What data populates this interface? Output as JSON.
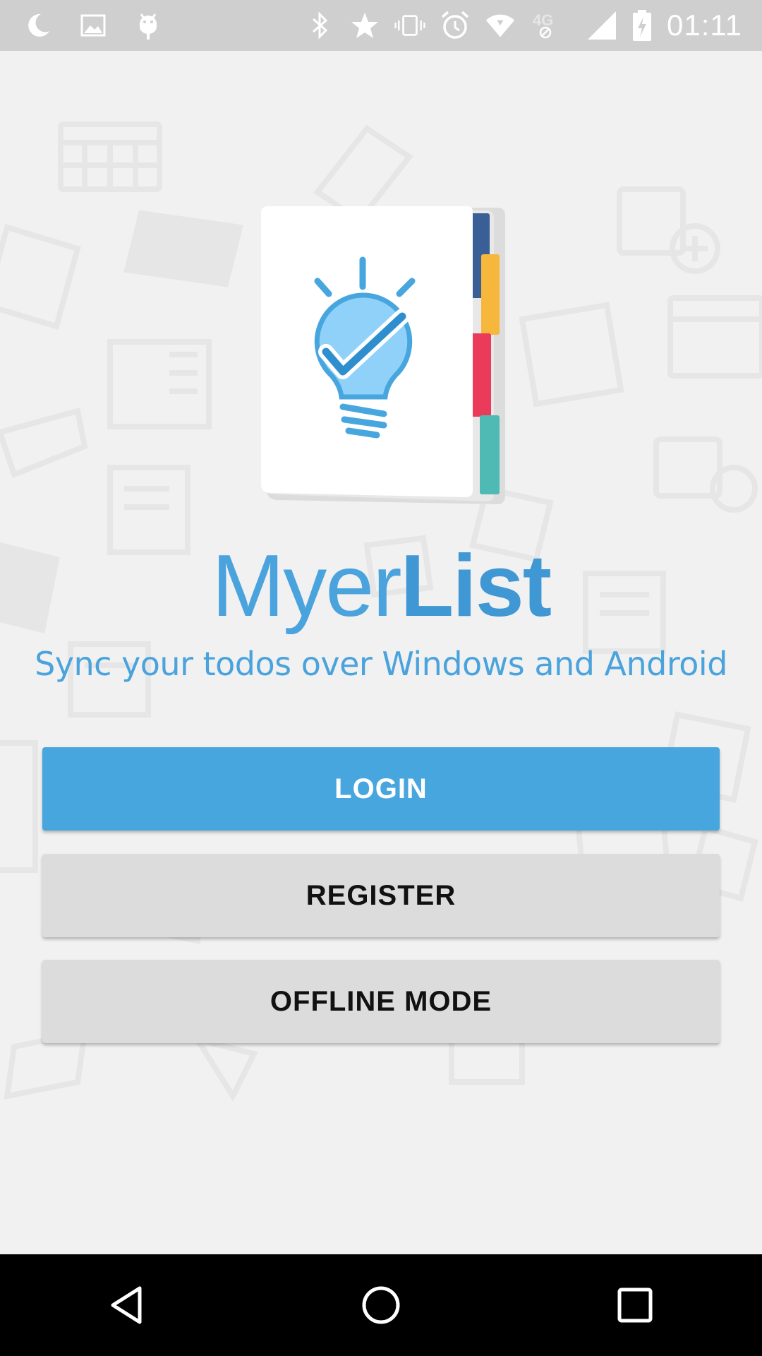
{
  "status_bar": {
    "time": "01:11",
    "network_label": "4G",
    "left_icons": [
      "moon-icon",
      "image-icon",
      "android-icon"
    ],
    "right_icons": [
      "bluetooth-icon",
      "star-icon",
      "vibrate-icon",
      "alarm-icon",
      "wifi-icon",
      "network-4g-icon",
      "cell-signal-icon",
      "battery-charging-icon"
    ]
  },
  "app": {
    "title_light": "Myer",
    "title_bold": "List",
    "tagline": "Sync your todos over Windows and Android"
  },
  "buttons": {
    "login": "LOGIN",
    "register": "REGISTER",
    "offline": "OFFLINE MODE"
  },
  "nav_bar": {
    "icons": [
      "back-icon",
      "home-icon",
      "recents-icon"
    ]
  },
  "colors": {
    "accent": "#48a6de",
    "status_bar": "#cfcfcf",
    "background": "#f1f1f1",
    "secondary_button": "#dcdcdc",
    "tab_navy": "#3a5f96",
    "tab_orange": "#f6b73c",
    "tab_red": "#ea3b5a",
    "tab_teal": "#4fbab3"
  }
}
